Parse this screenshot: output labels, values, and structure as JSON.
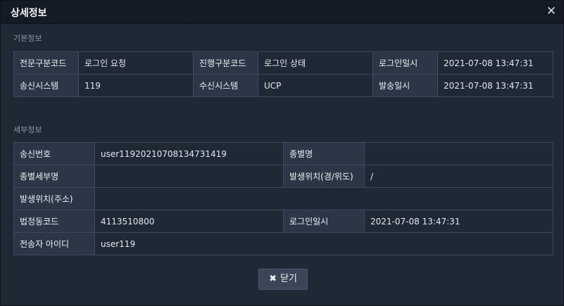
{
  "dialog": {
    "title": "상세정보",
    "close_icon": "✕"
  },
  "basic": {
    "section_label": "기본정보",
    "rows": [
      [
        "전문구분코드",
        "로그인 요청",
        "진행구분코드",
        "로그인 상태",
        "로그인일시",
        "2021-07-08 13:47:31"
      ],
      [
        "송신시스템",
        "119",
        "수신시스템",
        "UCP",
        "발송일시",
        "2021-07-08 13:47:31"
      ]
    ]
  },
  "detail": {
    "section_label": "세부정보",
    "send_no_label": "송신번호",
    "send_no_value": "user11920210708134731419",
    "type_name_label": "종별명",
    "type_name_value": "",
    "type_detail_label": "종별세부명",
    "type_detail_value": "",
    "location_coord_label": "발생위치(경/위도)",
    "location_coord_value": "/",
    "location_addr_label": "발생위치(주소)",
    "location_addr_value": "",
    "legal_code_label": "법정동코드",
    "legal_code_value": "4113510800",
    "login_time_label": "로그인일시",
    "login_time_value": "2021-07-08 13:47:31",
    "sender_id_label": "전송자 아이디",
    "sender_id_value": "user119"
  },
  "footer": {
    "close_label": "닫기",
    "close_icon": "✖"
  }
}
